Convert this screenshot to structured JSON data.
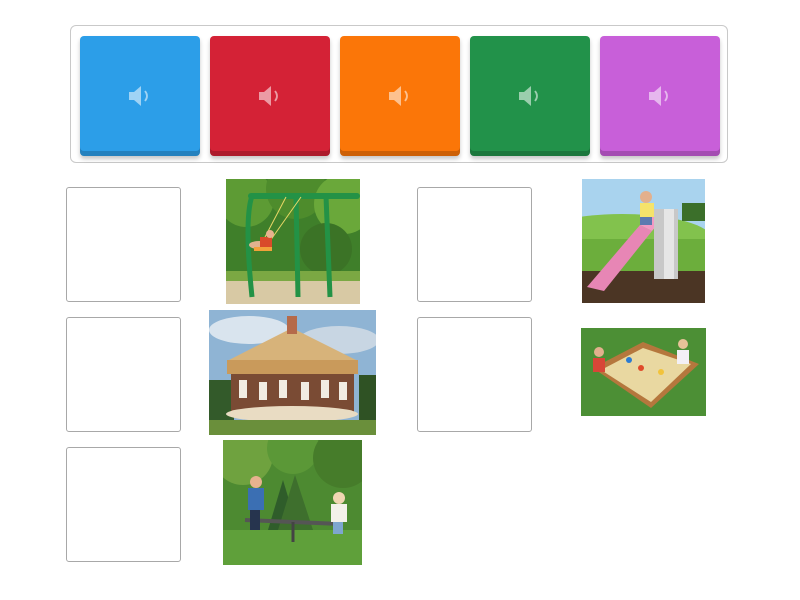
{
  "tiles": [
    {
      "id": "blue",
      "color": "#2c9ee8",
      "icon": "speaker-icon"
    },
    {
      "id": "red",
      "color": "#d42236",
      "icon": "speaker-icon"
    },
    {
      "id": "orange",
      "color": "#fb7608",
      "icon": "speaker-icon"
    },
    {
      "id": "green",
      "color": "#22924a",
      "icon": "speaker-icon"
    },
    {
      "id": "purple",
      "color": "#c85fd9",
      "icon": "speaker-icon"
    }
  ],
  "targets": [
    {
      "picture": "swing",
      "content": ""
    },
    {
      "picture": "slide",
      "content": ""
    },
    {
      "picture": "carousel",
      "content": ""
    },
    {
      "picture": "sandbox",
      "content": ""
    },
    {
      "picture": "seesaw",
      "content": ""
    }
  ]
}
